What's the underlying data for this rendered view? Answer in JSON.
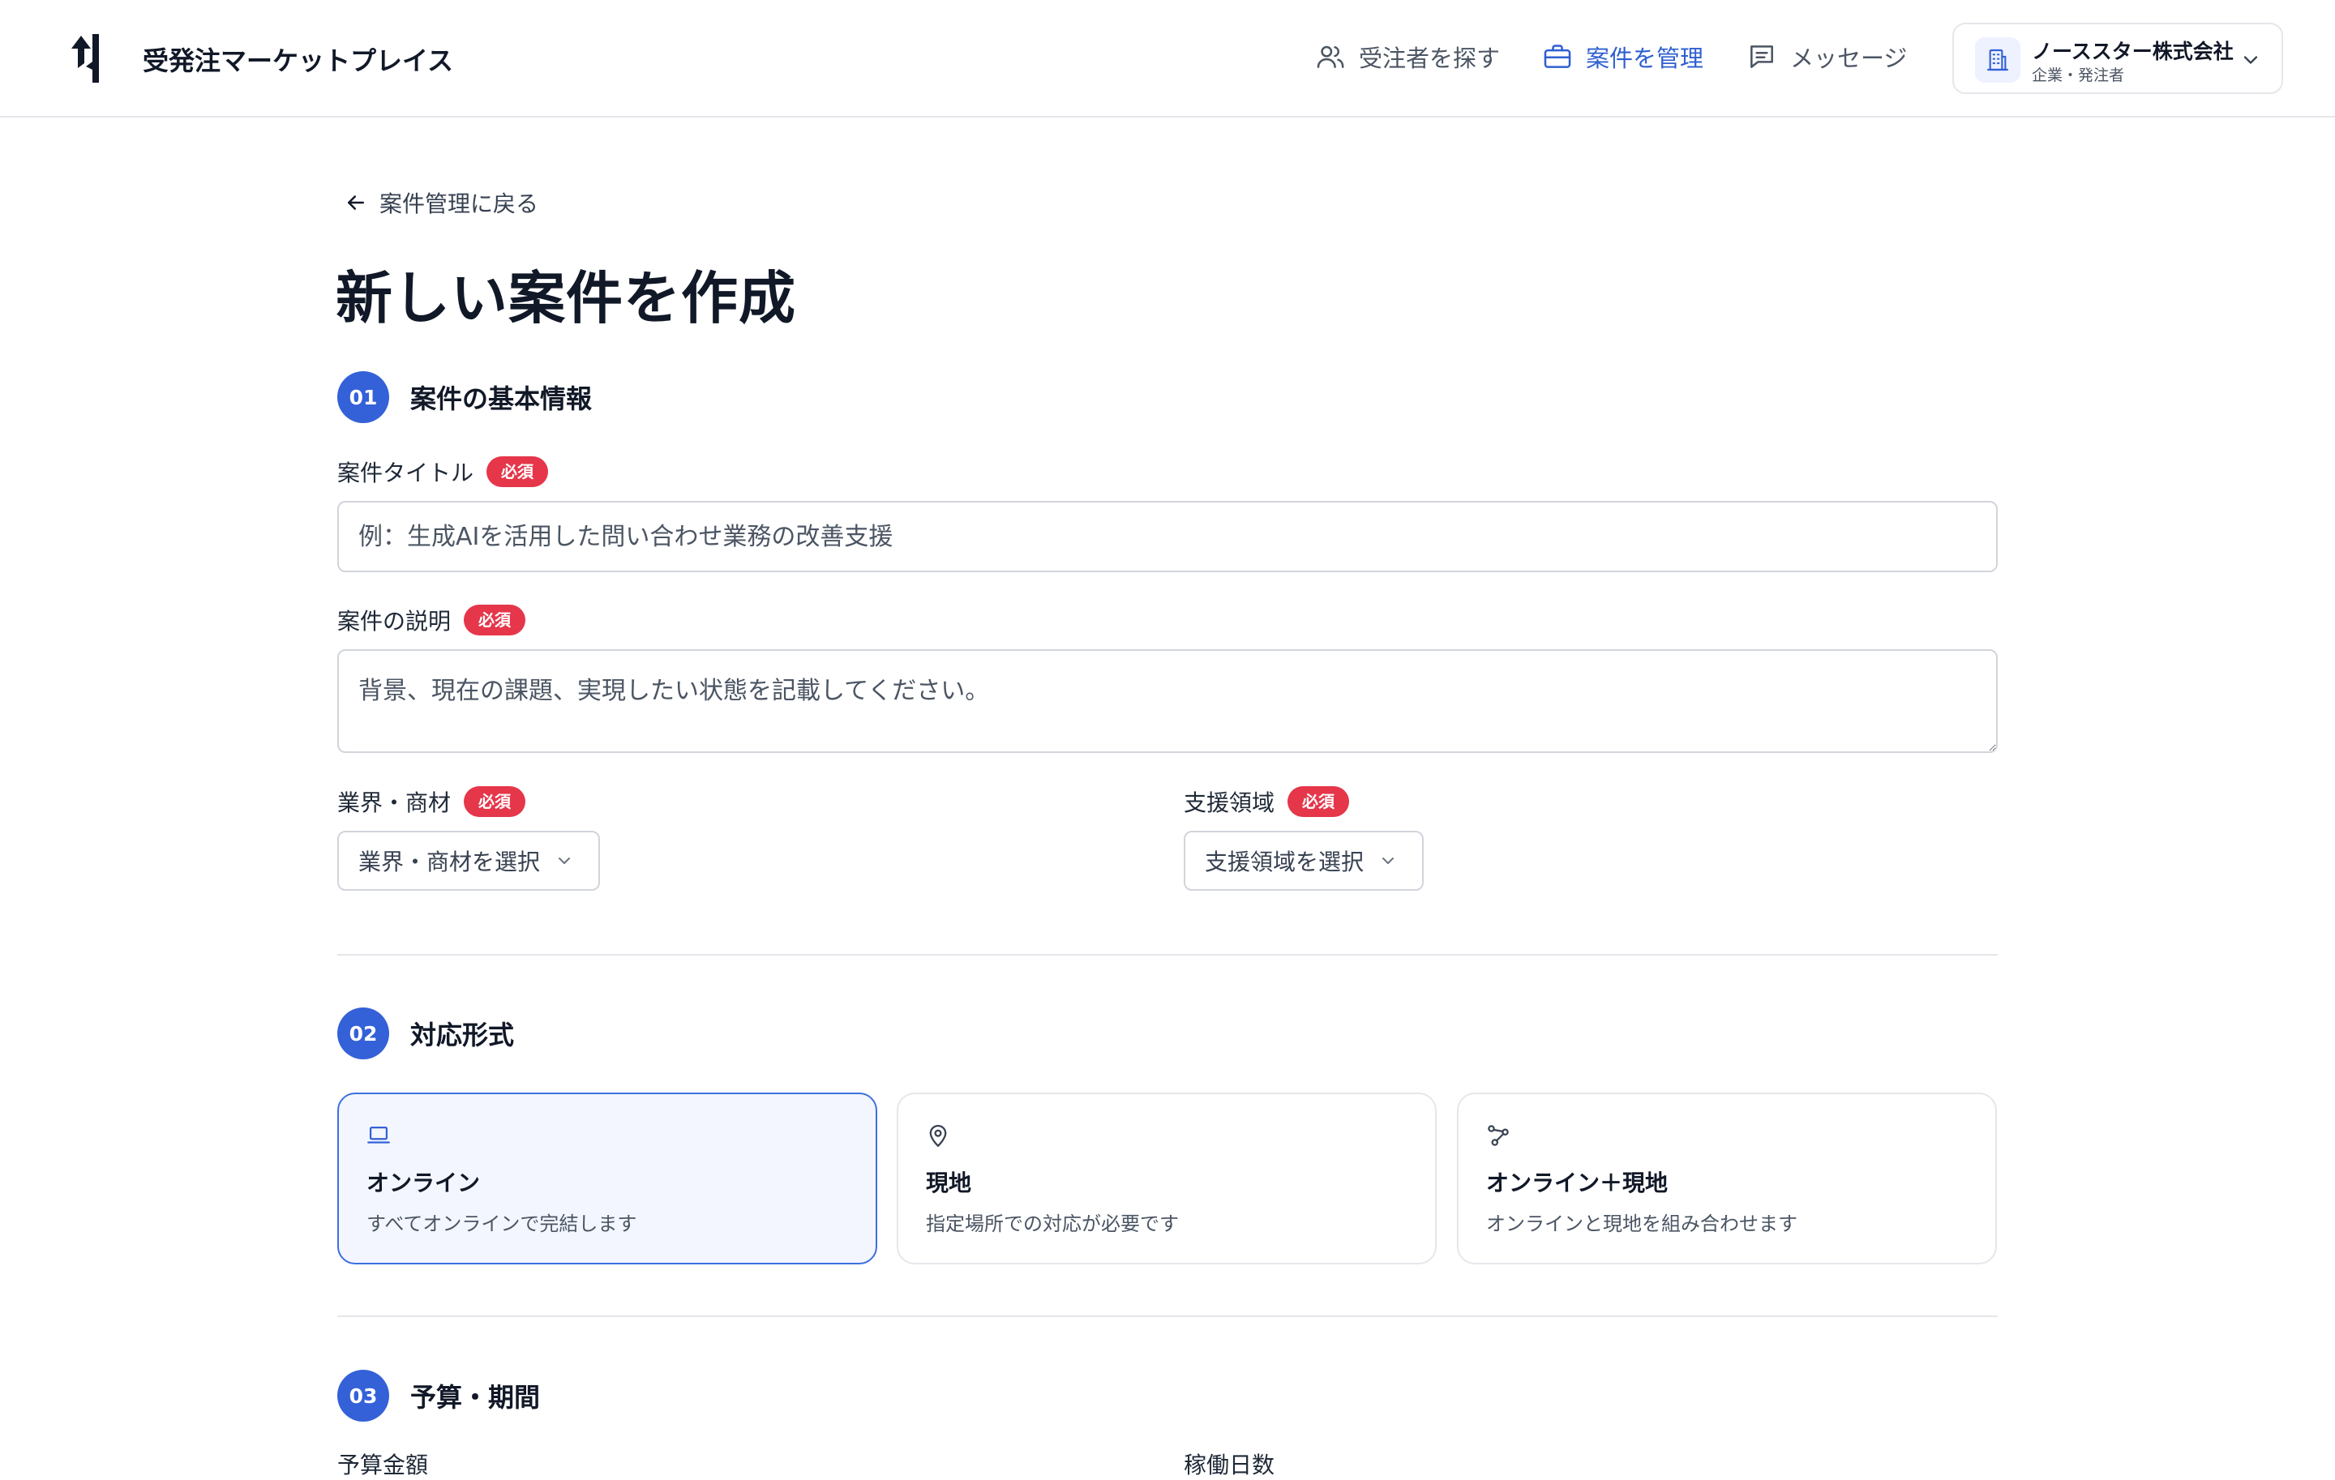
{
  "header": {
    "app_title": "受発注マーケットプレイス",
    "nav": [
      {
        "label": "受注者を探す",
        "icon": "users-icon"
      },
      {
        "label": "案件を管理",
        "icon": "briefcase-icon",
        "active": true
      },
      {
        "label": "メッセージ",
        "icon": "message-icon"
      }
    ],
    "account": {
      "name": "ノーススター株式会社",
      "role": "企業・発注者",
      "icon": "building-icon"
    }
  },
  "back_link": "案件管理に戻る",
  "page_title": "新しい案件を作成",
  "required_label": "必須",
  "section1": {
    "number": "01",
    "title": "案件の基本情報",
    "title_field": {
      "label": "案件タイトル",
      "placeholder": "例：生成AIを活用した問い合わせ業務の改善支援",
      "value": ""
    },
    "description_field": {
      "label": "案件の説明",
      "placeholder": "背景、現在の課題、実現したい状態を記載してください。",
      "value": ""
    },
    "industry": {
      "label": "業界・商材",
      "value": "業界・商材を選択"
    },
    "support_area": {
      "label": "支援領域",
      "value": "支援領域を選択"
    }
  },
  "section2": {
    "number": "02",
    "title": "対応形式",
    "options": [
      {
        "title": "オンライン",
        "desc": "すべてオンラインで完結します",
        "icon": "laptop-icon",
        "selected": true
      },
      {
        "title": "現地",
        "desc": "指定場所での対応が必要です",
        "icon": "map-pin-icon",
        "selected": false
      },
      {
        "title": "オンライン＋現地",
        "desc": "オンラインと現地を組み合わせます",
        "icon": "hybrid-icon",
        "selected": false
      }
    ]
  },
  "section3": {
    "number": "03",
    "title": "予算・期間",
    "field_left": "予算金額",
    "field_right": "稼働日数"
  },
  "colors": {
    "accent": "#3461d8",
    "required": "#e5364a",
    "selected_bg": "#f3f6fe"
  }
}
